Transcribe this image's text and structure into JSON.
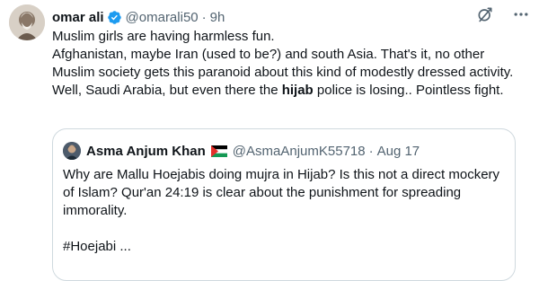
{
  "tweet": {
    "author_name": "omar ali",
    "handle": "@omarali50",
    "separator": "·",
    "time": "9h",
    "text_line1": "Muslim girls are having harmless fun.",
    "text_para2_before": "Afghanistan, maybe Iran (used to be?) and south Asia. That's it, no other Muslim society gets this paranoid about this kind of modestly dressed activity. Well, Saudi Arabia, but even there the ",
    "text_para2_bold": "hijab",
    "text_para2_after": " police is losing.. Pointless fight.",
    "icons": [
      "verified-badge-icon",
      "grok-icon",
      "more-icon"
    ],
    "verified_color": "#1d9bf0"
  },
  "quote": {
    "author_name": "Asma Anjum Khan",
    "flag": "palestine-flag-icon",
    "handle": "@AsmaAnjumK55718",
    "separator": "·",
    "date": "Aug 17",
    "text": "Why are Mallu Hoejabis doing mujra in Hijab? Is this not a direct mockery of Islam? Qur'an 24:19 is clear about the punishment for spreading immorality.",
    "hashtag_line": "#Hoejabi ..."
  }
}
